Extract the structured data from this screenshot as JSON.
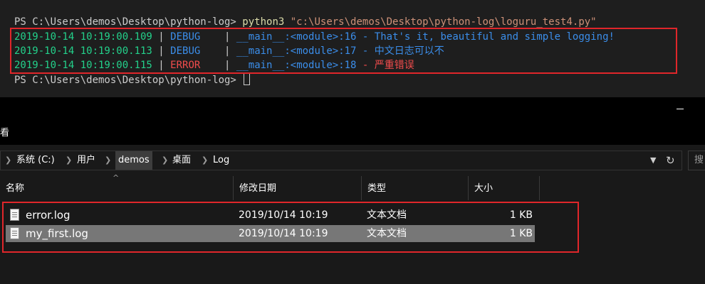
{
  "terminal": {
    "prompt": "PS C:\\Users\\demos\\Desktop\\python-log> ",
    "command": "python3",
    "command_arg": "\"c:\\Users\\demos\\Desktop\\python-log\\loguru_test4.py\"",
    "log_lines": [
      {
        "time": "2019-10-14 10:19:00.109",
        "level": "DEBUG   ",
        "location": "__main__:<module>:16",
        "message": "That's it, beautiful and simple logging!"
      },
      {
        "time": "2019-10-14 10:19:00.113",
        "level": "DEBUG   ",
        "location": "__main__:<module>:17",
        "message": "中文日志可以不"
      },
      {
        "time": "2019-10-14 10:19:00.115",
        "level": "ERROR   ",
        "location": "__main__:<module>:18",
        "message": "严重错误"
      }
    ],
    "separator": " | ",
    "dash": " - ",
    "final_prompt": "PS C:\\Users\\demos\\Desktop\\python-log> ",
    "colors": {
      "time": "#23d18b",
      "debug": "#3b8eea",
      "error": "#f14c4c",
      "highlight": "#e0262a"
    }
  },
  "window": {
    "partial_title": "看"
  },
  "explorer": {
    "breadcrumb": [
      "系统 (C:)",
      "用户",
      "demos",
      "桌面",
      "Log"
    ],
    "search_placeholder": "搜",
    "columns": {
      "name": "名称",
      "date": "修改日期",
      "type": "类型",
      "size": "大小"
    },
    "files": [
      {
        "name": "error.log",
        "date": "2019/10/14 10:19",
        "type": "文本文档",
        "size": "1 KB",
        "selected": false
      },
      {
        "name": "my_first.log",
        "date": "2019/10/14 10:19",
        "type": "文本文档",
        "size": "1 KB",
        "selected": true
      }
    ]
  }
}
